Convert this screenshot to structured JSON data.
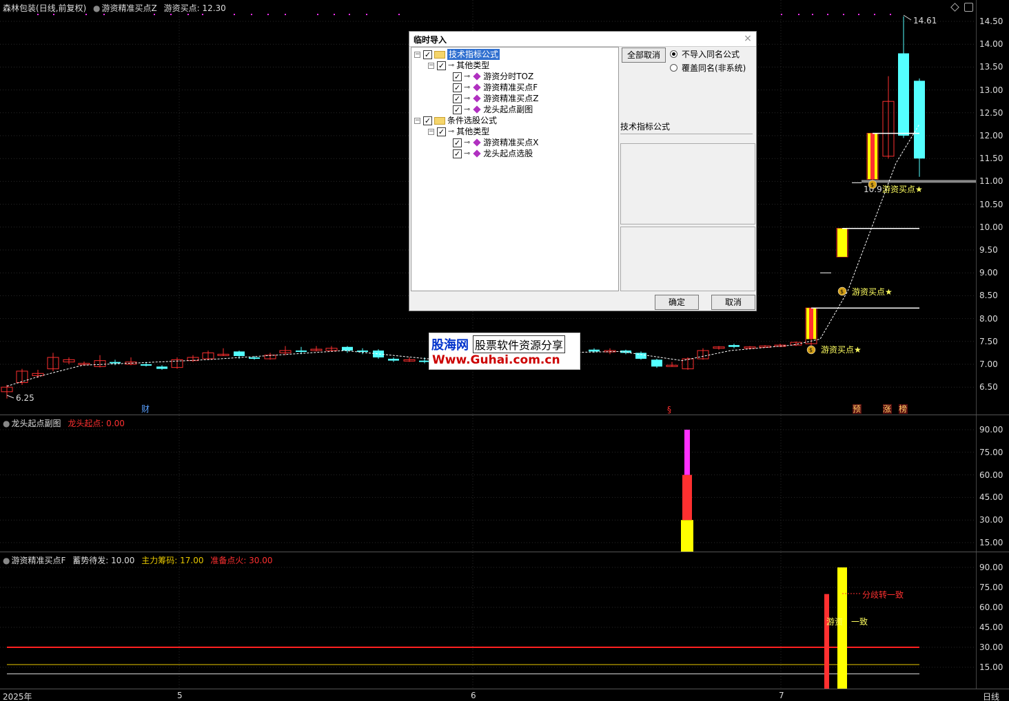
{
  "main_header": {
    "stock": "森林包装",
    "period": "(日线,前复权)",
    "indicator": "游资精准买点Z",
    "buy_label": "游资买点: 12.30"
  },
  "main_axis": [
    "14.50",
    "14.00",
    "13.50",
    "13.00",
    "12.50",
    "12.00",
    "11.50",
    "11.00",
    "10.50",
    "10.00",
    "9.50",
    "9.00",
    "8.50",
    "8.00",
    "7.50",
    "7.00",
    "6.50"
  ],
  "price_annotations": {
    "high": "14.61",
    "low": "6.25",
    "mid": "10.9",
    "buy_star_1": "游资买点★",
    "buy_star_2": "游资买点★",
    "buy_star_3": "游资买点★"
  },
  "event_markers": {
    "cai": "财",
    "s": "§",
    "yu": "预",
    "zhang": "涨",
    "bang": "榜"
  },
  "sub1_header": {
    "name": "龙头起点副图",
    "value": "龙头起点: 0.00"
  },
  "sub1_axis": [
    "90.00",
    "75.00",
    "60.00",
    "45.00",
    "30.00",
    "15.00"
  ],
  "sub2_header": {
    "name": "游资精准买点F",
    "v1": "蓄势待发: 10.00",
    "v2": "主力筹码: 17.00",
    "v3": "准备点火: 30.00"
  },
  "sub2_axis": [
    "90.00",
    "75.00",
    "60.00",
    "45.00",
    "30.00",
    "15.00"
  ],
  "sub2_labels": {
    "divergence": "分歧转一致",
    "youzi": "游资",
    "yizhi": "一致"
  },
  "time_axis": {
    "year": "2025年",
    "m5": "5",
    "m6": "6",
    "m7": "7",
    "period": "日线"
  },
  "dialog": {
    "title": "临时导入",
    "close": "×",
    "tree": {
      "root1": "技术指标公式",
      "root1_child": "其他类型",
      "items1": [
        "游资分时TOZ",
        "游资精准买点F",
        "游资精准买点Z",
        "龙头起点副图"
      ],
      "root2": "条件选股公式",
      "root2_child": "其他类型",
      "items2": [
        "游资精准买点X",
        "龙头起点选股"
      ]
    },
    "cancel_all": "全部取消",
    "radio1": "不导入同名公式",
    "radio2": "覆盖同名(非系统)",
    "category": "技术指标公式",
    "ok": "确定",
    "cancel": "取消"
  },
  "watermark": {
    "brand": "股海网",
    "slogan": "股票软件资源分享",
    "url": "Www.Guhai.com.cn"
  },
  "colors": {
    "up": "#ff3030",
    "down": "#54ffff",
    "yellow": "#ffff00",
    "magenta": "#ff30ff"
  }
}
